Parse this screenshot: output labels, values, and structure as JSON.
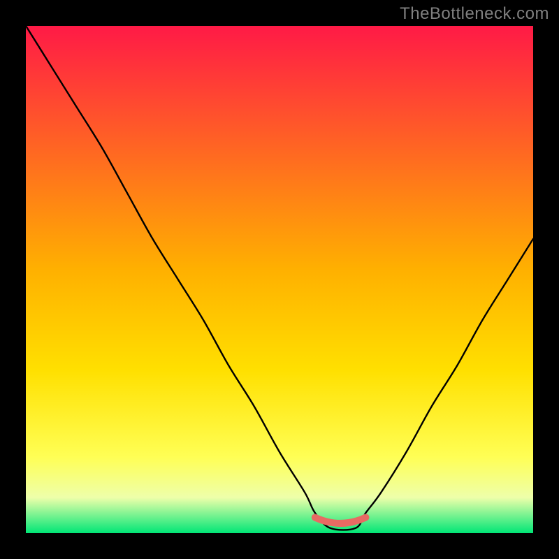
{
  "watermark": "TheBottleneck.com",
  "colors": {
    "frame": "#000000",
    "grad_top": "#ff1a46",
    "grad_mid": "#ffd400",
    "grad_yellowlight": "#ffff66",
    "grad_pale": "#ffffcc",
    "grad_bottom": "#00e676",
    "curve": "#000000",
    "marker": "#e86a63"
  },
  "chart_data": {
    "type": "line",
    "title": "",
    "xlabel": "",
    "ylabel": "",
    "xlim": [
      0,
      100
    ],
    "ylim": [
      0,
      100
    ],
    "series": [
      {
        "name": "bottleneck-curve",
        "x": [
          0,
          5,
          10,
          15,
          20,
          25,
          30,
          35,
          40,
          45,
          50,
          55,
          57,
          60,
          65,
          67,
          70,
          75,
          80,
          85,
          90,
          95,
          100
        ],
        "y": [
          100,
          92,
          84,
          76,
          67,
          58,
          50,
          42,
          33,
          25,
          16,
          8,
          4,
          1,
          1,
          4,
          8,
          16,
          25,
          33,
          42,
          50,
          58
        ]
      }
    ],
    "marker": {
      "name": "optimal-range",
      "x_range": [
        57,
        67
      ],
      "y": 1.6
    }
  }
}
